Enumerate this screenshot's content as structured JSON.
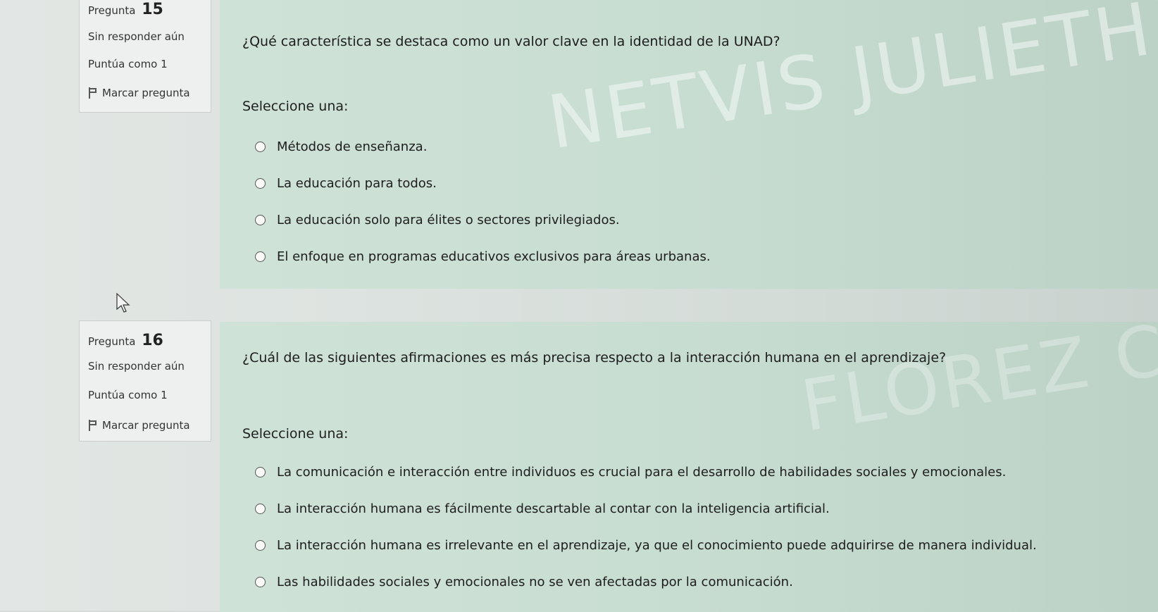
{
  "questions": [
    {
      "number_label": "Pregunta",
      "number": "15",
      "state": "Sin responder aún",
      "grade": "Puntúa como 1",
      "flag_label": "Marcar pregunta",
      "text": "¿Qué característica se destaca como un valor clave en la identidad de la UNAD?",
      "prompt": "Seleccione una:",
      "answers": [
        "Métodos de enseñanza.",
        "La educación para todos.",
        "La educación solo para élites o sectores privilegiados.",
        "El enfoque en programas educativos exclusivos para áreas urbanas."
      ]
    },
    {
      "number_label": "Pregunta",
      "number": "16",
      "state": "Sin responder aún",
      "grade": "Puntúa como 1",
      "flag_label": "Marcar pregunta",
      "text": "¿Cuál de las siguientes afirmaciones es más precisa respecto a la interacción humana en el aprendizaje?",
      "prompt": "Seleccione una:",
      "answers": [
        "La comunicación e interacción entre individuos es crucial para el desarrollo de habilidades sociales y emocionales.",
        "La interacción humana es fácilmente descartable al contar con la inteligencia artificial.",
        "La interacción humana es irrelevante en el aprendizaje, ya que el conocimiento puede adquirirse de manera individual.",
        "Las habilidades sociales y emocionales no se ven afectadas por la comunicación."
      ]
    }
  ],
  "watermark": {
    "line1": "NETVIS JULIETH FLOREZ CAM",
    "line2": "FLOREZ CAM"
  }
}
